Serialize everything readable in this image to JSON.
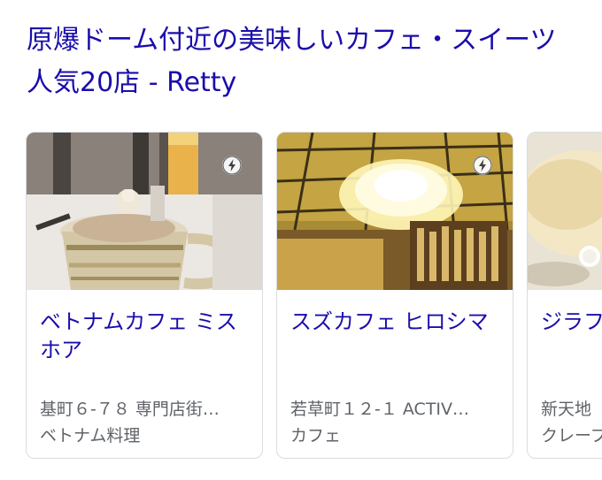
{
  "result": {
    "title": "原爆ドーム付近の美味しいカフェ・スイーツ 人気20店 - Retty"
  },
  "cards": [
    {
      "name": "ベトナムカフェ ミスホア",
      "address": "基町６-７８ 専門店街…",
      "category": "ベトナム料理",
      "amp_icon": "lightning-bolt-icon"
    },
    {
      "name": "スズカフェ ヒロシマ",
      "address": "若草町１２-１ ACTIV…",
      "category": "カフェ",
      "amp_icon": "lightning-bolt-icon"
    },
    {
      "name": "ジラフ 中央通",
      "address": "新天地",
      "category": "クレープ",
      "amp_icon": ""
    }
  ],
  "colors": {
    "link": "#1a0dab",
    "secondary_text": "#5f6368",
    "card_border": "#dadce0"
  }
}
